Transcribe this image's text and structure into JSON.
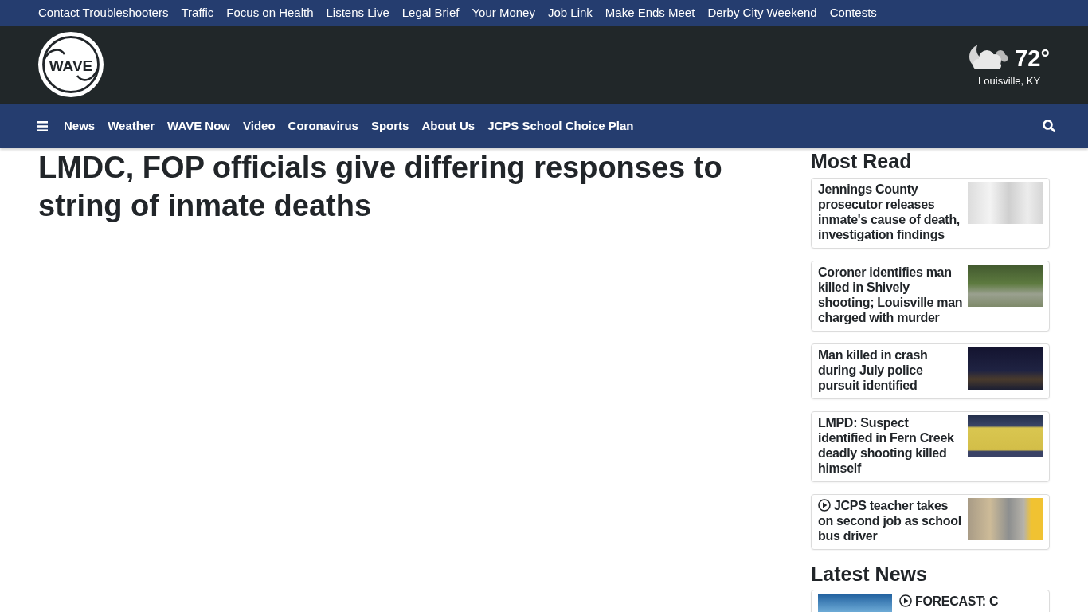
{
  "top_links": [
    "Contact Troubleshooters",
    "Traffic",
    "Focus on Health",
    "Listens Live",
    "Legal Brief",
    "Your Money",
    "Job Link",
    "Make Ends Meet",
    "Derby City Weekend",
    "Contests"
  ],
  "header": {
    "logo": {
      "text": "WAVE"
    },
    "weather": {
      "temperature": "72°",
      "location": "Louisville, KY"
    }
  },
  "nav": {
    "items": [
      "News",
      "Weather",
      "WAVE Now",
      "Video",
      "Coronavirus",
      "Sports",
      "About Us",
      "JCPS School Choice Plan"
    ]
  },
  "article": {
    "headline": "LMDC, FOP officials give differing responses to string of inmate deaths"
  },
  "most_read": {
    "title": "Most Read",
    "stories": [
      {
        "headline": "Jennings County prosecutor releases inmate's cause of death, investigation findings",
        "video": false
      },
      {
        "headline": "Coroner identifies man killed in Shively shooting; Louisville man charged with murder",
        "video": false
      },
      {
        "headline": "Man killed in crash during July police pursuit identified",
        "video": false
      },
      {
        "headline": "LMPD: Suspect identified in Fern Creek deadly shooting killed himself",
        "video": false
      },
      {
        "headline": "JCPS teacher takes on second job as school bus driver",
        "video": true
      }
    ]
  },
  "latest_news": {
    "title": "Latest News",
    "stories": [
      {
        "headline": "FORECAST: C",
        "video": true
      }
    ]
  }
}
